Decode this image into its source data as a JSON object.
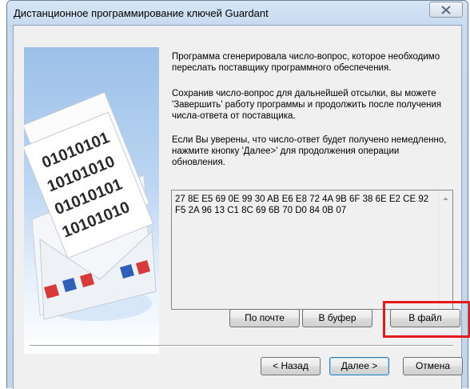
{
  "window": {
    "title": "Дистанционное программирование ключей Guardant"
  },
  "messages": {
    "p1": "Программа сгенерировала число-вопрос, которое необходимо переслать поставщику программного обеспечения.",
    "p2": "Сохранив число-вопрос для дальнейшей отсылки, вы можете 'Завершить' работу программы и продолжить после получения числа-ответа от поставщика.",
    "p3": "Если Вы уверены, что число-ответ будет получено немедленно, нажмите кнопку 'Далее>' для продолжения операции обновления."
  },
  "code": {
    "value": "27 8E E5 69 0E 99 30 AB E6 E8 72 4A 9B 6F 38 6E E2 CE 92 F5 2A 96 13 C1 8C 69 6B 70 D0 84 0B 07"
  },
  "actions": {
    "mail_label": "По почте",
    "clipboard_label": "В буфер",
    "file_label": "В файл"
  },
  "nav": {
    "back_label": "< Назад",
    "next_label": "Далее >",
    "cancel_label": "Отмена"
  },
  "art": {
    "envelope_digits": [
      "01010101",
      "10101010",
      "01010101",
      "10101010"
    ]
  },
  "colors": {
    "highlight": "#e51b1b",
    "title_bg": "#c7dbf0"
  }
}
